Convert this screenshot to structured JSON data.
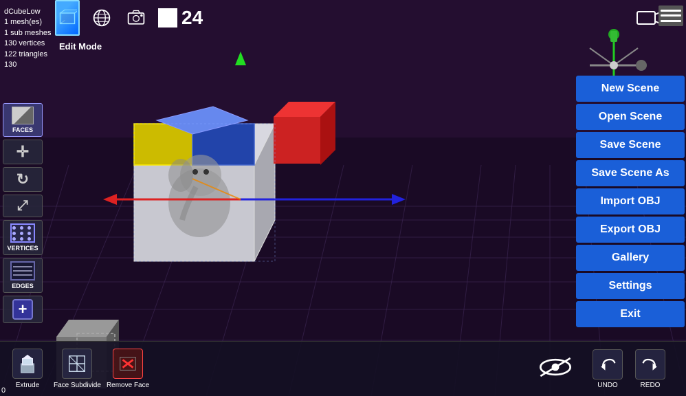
{
  "info": {
    "mesh_name": "dCubeLow",
    "mesh_count": "1 mesh(es)",
    "sub_meshes": "1 sub meshes",
    "vertices": "130 vertices",
    "triangles": "122 triangles",
    "number": "130"
  },
  "toolbar": {
    "edit_mode_label": "Edit Mode",
    "frame_number": "24"
  },
  "left_tools": [
    {
      "id": "faces",
      "label": "FACES"
    },
    {
      "id": "move",
      "label": ""
    },
    {
      "id": "undo-rotate",
      "label": ""
    },
    {
      "id": "scale",
      "label": ""
    },
    {
      "id": "vertices",
      "label": "VERTICES"
    },
    {
      "id": "edges",
      "label": "EDGES"
    },
    {
      "id": "add",
      "label": ""
    }
  ],
  "menu": {
    "items": [
      {
        "id": "new-scene",
        "label": "New Scene"
      },
      {
        "id": "open-scene",
        "label": "Open Scene"
      },
      {
        "id": "save-scene",
        "label": "Save Scene"
      },
      {
        "id": "save-scene-as",
        "label": "Save Scene As"
      },
      {
        "id": "import-obj",
        "label": "Import OBJ"
      },
      {
        "id": "export-obj",
        "label": "Export OBJ"
      },
      {
        "id": "gallery",
        "label": "Gallery"
      },
      {
        "id": "settings",
        "label": "Settings"
      },
      {
        "id": "exit",
        "label": "Exit"
      }
    ]
  },
  "bottom_tools": [
    {
      "id": "extrude",
      "label": "Extrude",
      "icon": "⬆"
    },
    {
      "id": "face-subdivide",
      "label": "Face Subdivide",
      "icon": "⧉"
    },
    {
      "id": "remove-face",
      "label": "Remove Face",
      "icon": "✕"
    }
  ],
  "undo_redo": {
    "undo_label": "UNDO",
    "redo_label": "REDO",
    "undo_icon": "↩",
    "redo_icon": "↪"
  },
  "coord": {
    "value": "0"
  },
  "colors": {
    "menu_bg": "#1a5fd8",
    "axis_x": "#cc2020",
    "axis_y": "#22cc22",
    "axis_z": "#2020cc"
  }
}
